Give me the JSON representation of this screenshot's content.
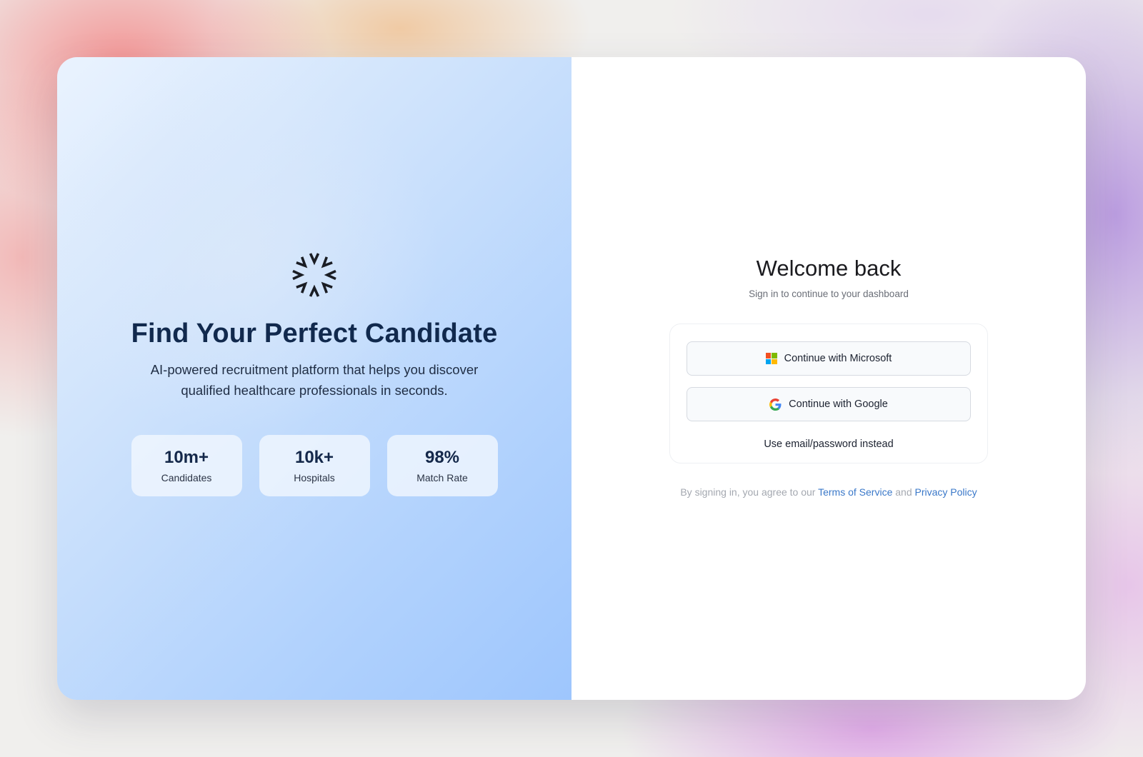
{
  "hero": {
    "logo_icon": "burst-logo-icon",
    "title": "Find Your Perfect Candidate",
    "subtitle": "AI-powered recruitment platform that helps you discover qualified healthcare professionals in seconds.",
    "stats": [
      {
        "value": "10m+",
        "label": "Candidates"
      },
      {
        "value": "10k+",
        "label": "Hospitals"
      },
      {
        "value": "98%",
        "label": "Match Rate"
      }
    ]
  },
  "signin": {
    "title": "Welcome back",
    "subtitle": "Sign in to continue to your dashboard",
    "microsoft_label": "Continue with Microsoft",
    "google_label": "Continue with Google",
    "email_link": "Use email/password instead",
    "legal_prefix": "By signing in, you agree to our",
    "terms_label": "Terms of Service",
    "legal_and": "and",
    "privacy_label": "Privacy Policy"
  },
  "colors": {
    "hero_title": "#11294d",
    "link": "#3a78c9",
    "ms_red": "#f25022",
    "ms_green": "#7fba00",
    "ms_blue": "#00a4ef",
    "ms_yellow": "#ffb900"
  }
}
